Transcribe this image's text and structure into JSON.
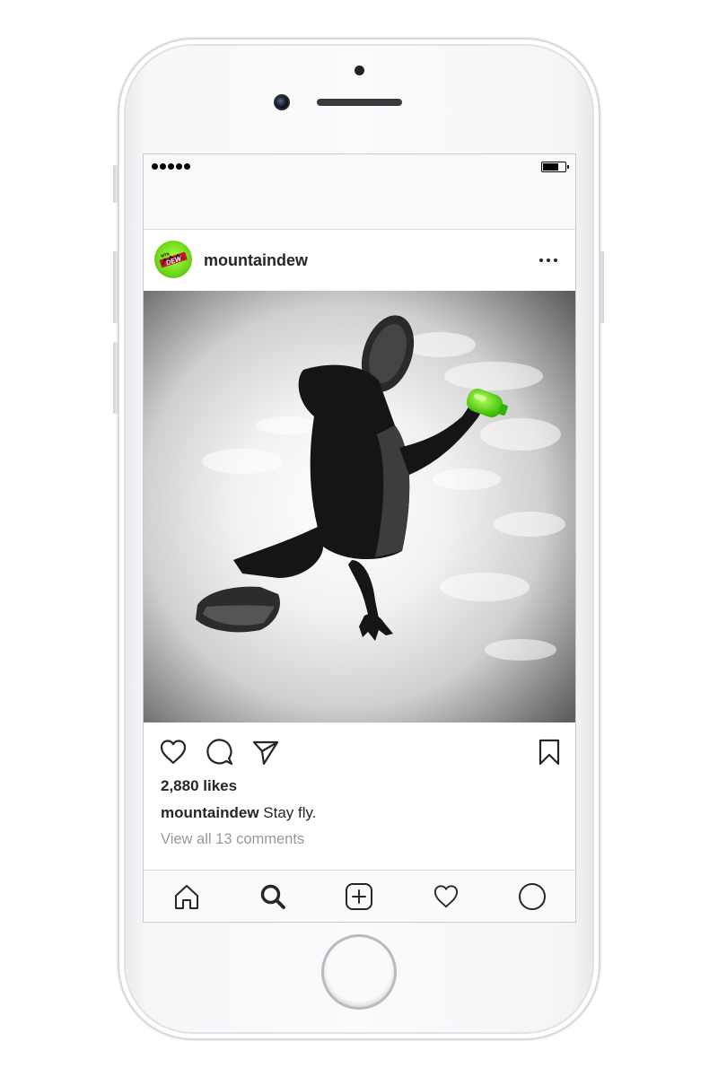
{
  "post": {
    "username": "mountaindew",
    "likes": "2,880 likes",
    "caption_user": "mountaindew",
    "caption_text": " Stay fly.",
    "comments_link": "View all 13 comments",
    "avatar_logo_text": "MTN DEW"
  },
  "icons": {
    "status": [
      "signal-icon",
      "battery-icon"
    ],
    "header": [
      "more-icon"
    ],
    "actions": [
      "heart-icon",
      "comment-icon",
      "share-icon",
      "bookmark-icon"
    ],
    "tabs": [
      "home-icon",
      "search-icon",
      "new-post-icon",
      "activity-icon",
      "profile-icon"
    ]
  },
  "colors": {
    "brand_green": "#6fd61a",
    "bottle_green": "#45e60c",
    "text": "#262626",
    "muted": "#999999"
  }
}
